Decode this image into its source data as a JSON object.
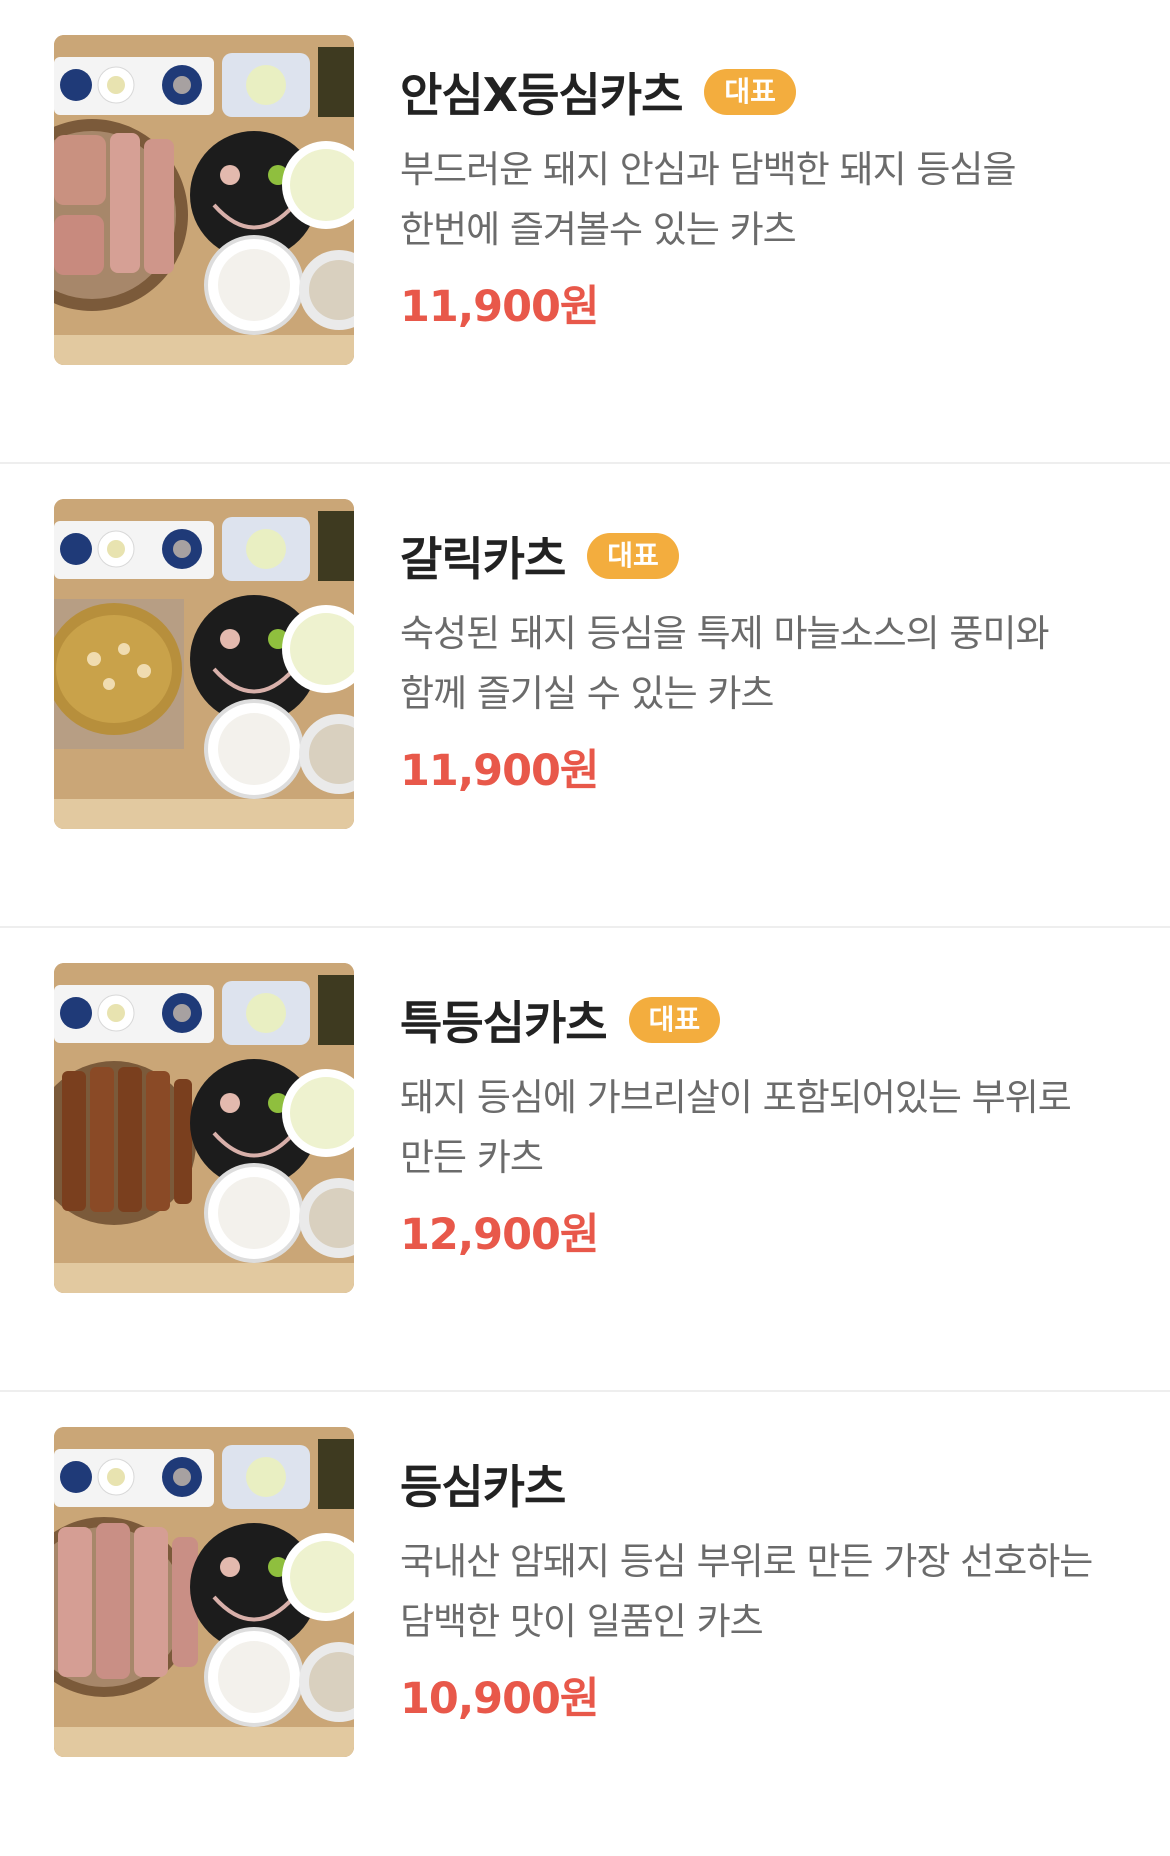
{
  "colors": {
    "badge_bg": "#f3ad3e",
    "price": "#e8584a",
    "name": "#222222",
    "description": "#6b6b6b"
  },
  "menu": [
    {
      "name": "안심X등심카츠",
      "badge": "대표",
      "description": "부드러운 돼지 안심과 담백한 돼지 등심을 한번에 즐겨볼수 있는 카츠",
      "price": "11,900원",
      "image": "food-photo-tonkatsu-set"
    },
    {
      "name": "갈릭카츠",
      "badge": "대표",
      "description": "숙성된 돼지 등심을 특제 마늘소스의 풍미와 함께 즐기실 수 있는 카츠",
      "price": "11,900원",
      "image": "food-photo-garlic-katsu-set"
    },
    {
      "name": "특등심카츠",
      "badge": "대표",
      "description": "돼지 등심에 가브리살이 포함되어있는 부위로 만든 카츠",
      "price": "12,900원",
      "image": "food-photo-tonkatsu-set"
    },
    {
      "name": "등심카츠",
      "badge": "",
      "description": "국내산 암돼지 등심 부위로 만든 가장 선호하는 담백한 맛이 일품인 카츠",
      "price": "10,900원",
      "image": "food-photo-tonkatsu-set"
    }
  ]
}
